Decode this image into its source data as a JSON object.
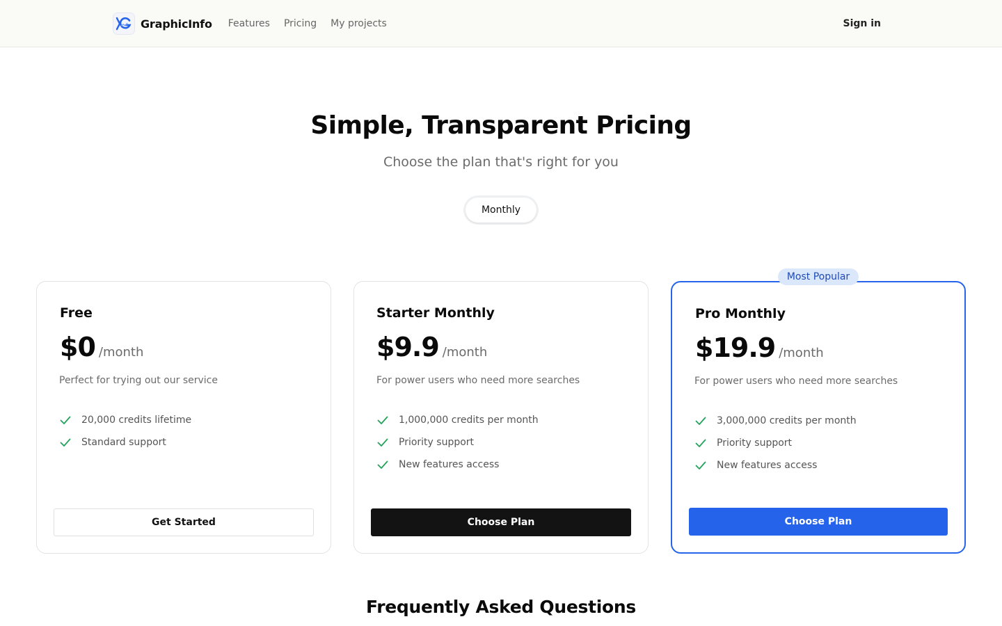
{
  "nav": {
    "brand": "GraphicInfo",
    "links": [
      "Features",
      "Pricing",
      "My projects"
    ],
    "sign_in": "Sign in"
  },
  "hero": {
    "title": "Simple, Transparent Pricing",
    "subtitle": "Choose the plan that's right for you"
  },
  "billing_toggle": {
    "selected": "Monthly"
  },
  "plans": [
    {
      "name": "Free",
      "price": "$0",
      "period": "/month",
      "description": "Perfect for trying out our service",
      "features": [
        "20,000 credits lifetime",
        "Standard support"
      ],
      "button": "Get Started"
    },
    {
      "name": "Starter Monthly",
      "price": "$9.9",
      "period": "/month",
      "description": "For power users who need more searches",
      "features": [
        "1,000,000 credits per month",
        "Priority support",
        "New features access"
      ],
      "button": "Choose Plan"
    },
    {
      "name": "Pro Monthly",
      "price": "$19.9",
      "period": "/month",
      "description": "For power users who need more searches",
      "features": [
        "3,000,000 credits per month",
        "Priority support",
        "New features access"
      ],
      "button": "Choose Plan",
      "badge": "Most Popular"
    }
  ],
  "faq": {
    "title": "Frequently Asked Questions"
  },
  "colors": {
    "accent": "#2563eb",
    "check": "#22a35a",
    "dark_button": "#131313"
  }
}
